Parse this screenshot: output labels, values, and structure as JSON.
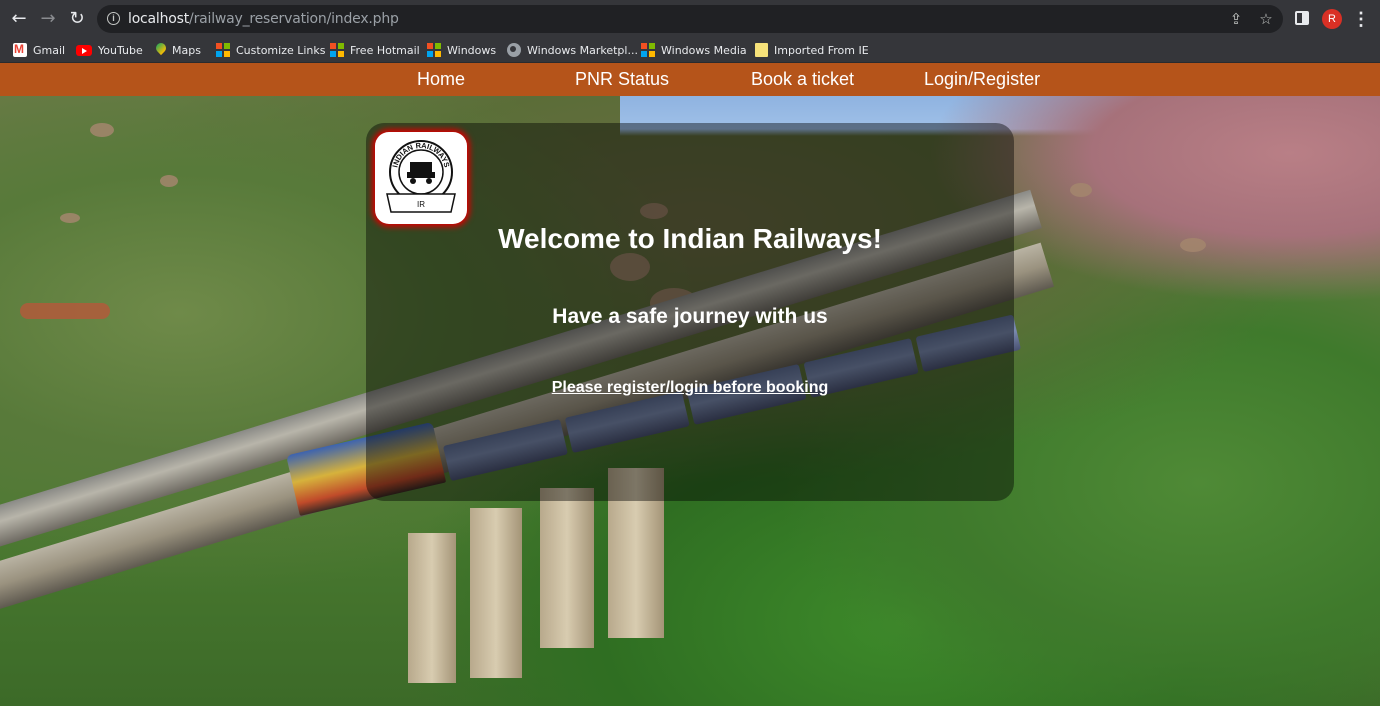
{
  "browser": {
    "url_host": "localhost",
    "url_path": "/railway_reservation/index.php",
    "profile_initial": "R",
    "bookmarks": [
      {
        "label": "Gmail",
        "icon": "gmail-icon"
      },
      {
        "label": "YouTube",
        "icon": "youtube-icon"
      },
      {
        "label": "Maps",
        "icon": "maps-icon"
      },
      {
        "label": "Customize Links",
        "icon": "microsoft-icon"
      },
      {
        "label": "Free Hotmail",
        "icon": "microsoft-icon"
      },
      {
        "label": "Windows",
        "icon": "microsoft-icon"
      },
      {
        "label": "Windows Marketpl...",
        "icon": "globe-icon"
      },
      {
        "label": "Windows Media",
        "icon": "microsoft-icon"
      },
      {
        "label": "Imported From IE",
        "icon": "folder-icon"
      }
    ]
  },
  "nav": {
    "links": [
      "Home",
      "PNR Status",
      "Book a ticket",
      "Login/Register"
    ],
    "bg_color": "#b5541a"
  },
  "hero": {
    "logo_text": "INDIAN RAILWAYS",
    "logo_label": "IR",
    "title": "Welcome to Indian Railways!",
    "subtitle": "Have a safe journey with us",
    "cta_link": "Please register/login before booking"
  }
}
